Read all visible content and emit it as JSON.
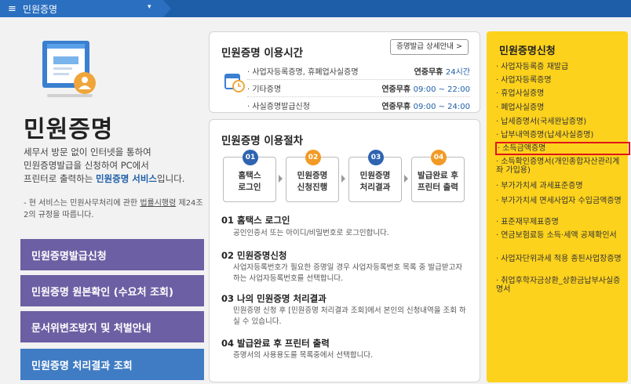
{
  "topbar": {
    "menu_label": "민원증명",
    "menu_icon": "hamburger-icon",
    "caret": "▾"
  },
  "left": {
    "title": "민원증명",
    "desc_line1": "세무서 방문 없이 인터넷을 통하여",
    "desc_line2": "민원증명발급을 신청하여 PC에서",
    "desc_line3_pre": "프린터로 출력하는 ",
    "desc_line3_hl": "민원증명 서비스",
    "desc_line3_post": "입니다.",
    "note_pre": "- 현 서비스는 민원사무처리에 관한 ",
    "note_u": "법률시행령",
    "note_post": " 제24조2의 규정을 따릅니다.",
    "buttons": [
      "민원증명발급신청",
      "민원증명 원본확인 (수요처 조회)",
      "문서위변조방지 및 처벌안내",
      "민원증명 처리결과 조회"
    ]
  },
  "hours": {
    "title": "민원증명 이용시간",
    "detail_button": "증명발급 상세안내 >",
    "rows": [
      {
        "name": "· 사업자등록증명, 휴폐업사실증명",
        "val_pre": "연중무휴 ",
        "val_time": "24시간"
      },
      {
        "name": "· 기타증명",
        "val_pre": "연중무휴 ",
        "val_time": "09:00 ~ 22:00"
      },
      {
        "name": "· 사실증명발급신청",
        "val_pre": "연중무휴 ",
        "val_time": "09:00 ~ 24:00"
      }
    ]
  },
  "procedure": {
    "title": "민원증명 이용절차",
    "steps": [
      {
        "num": "01",
        "label": "홈택스\n로그인"
      },
      {
        "num": "02",
        "label": "민원증명\n신청진행"
      },
      {
        "num": "03",
        "label": "민원증명\n처리결과"
      },
      {
        "num": "04",
        "label": "발급완료 후\n프린터 출력"
      }
    ],
    "sections": [
      {
        "heading": "01 홈택스 로그인",
        "text": "공인인증서 또는 아이디/비밀번호로 로그인합니다."
      },
      {
        "heading": "02 민원증명신청",
        "text": "사업자등록번호가 필요한 증명일 경우 사업자등록번호 목록 중 발급받고자 하는 사업자등록번호를 선택합니다."
      },
      {
        "heading": "03 나의 민원증명 처리결과",
        "text": "민원증명 신청 후 [민원증명 처리결과 조회]에서 본인의 신청내역을 조회 하실 수 있습니다."
      },
      {
        "heading": "04 발급완료 후 프린터 출력",
        "text": "증명서의 사용용도를 목록중에서 선택합니다."
      }
    ]
  },
  "right": {
    "title": "민원증명신청",
    "links": [
      "사업자등록증 재발급",
      "사업자등록증명",
      "휴업사실증명",
      "폐업사실증명",
      "납세증명서(국세완납증명)",
      "납부내역증명(납세사실증명)",
      "소득금액증명",
      "소득확인증명서(개인종합자산관리계좌 가입용)",
      "부가가치세 과세표준증명",
      "부가가치세 면세사업자 수입금액증명",
      "표준재무제표증명",
      "연금보험료등 소득·세액 공제확인서",
      "사업자단위과세 적용 종된사업장증명",
      "취업후학자금상환_상환금납부사실증명서"
    ],
    "selected_index": 6
  },
  "colors": {
    "topbar": "#1e5ea8",
    "accent_blue": "#1e5ea8",
    "purple_button": "#6c5fa3",
    "blue_button": "#3f7cc4",
    "yellow_panel": "#fdd21c",
    "highlight_red": "#e0151a",
    "orange_step": "#f29a25"
  }
}
